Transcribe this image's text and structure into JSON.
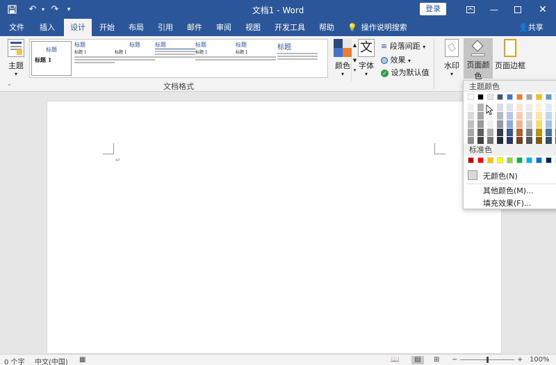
{
  "titlebar": {
    "title": "文档1 - Word",
    "login": "登录"
  },
  "tabs": [
    "文件",
    "插入",
    "设计",
    "开始",
    "布局",
    "引用",
    "邮件",
    "审阅",
    "视图",
    "开发工具",
    "帮助"
  ],
  "active_tab": "设计",
  "tell_me": "操作说明搜索",
  "share": "共享",
  "ribbon": {
    "theme": "主题",
    "theme_thumb_label": "标题 1",
    "gallery_titles": [
      "标题",
      "标题",
      "标题",
      "标题",
      "标题",
      "标题",
      "标题"
    ],
    "gallery_sub": [
      "标题 1",
      "标题 1",
      "标题 1",
      "标题 1"
    ],
    "doc_format_label": "文档格式",
    "colors": "颜色",
    "fonts": "字体",
    "paragraph_spacing": "段落间距",
    "effects": "效果",
    "set_default": "设为默认值",
    "watermark": "水印",
    "page_color": "页面颜色",
    "page_borders": "页面边框"
  },
  "dropdown": {
    "theme_colors": "主题颜色",
    "standard_colors": "标准色",
    "no_color": "无颜色(N)",
    "more_colors": "其他颜色(M)...",
    "fill_effects": "填充效果(F)...",
    "theme_top_row": [
      "#ffffff",
      "#000000",
      "#e7e6e6",
      "#44546a",
      "#4472c4",
      "#ed7d31",
      "#a5a5a5",
      "#ffc000",
      "#5b9bd5",
      "#70ad47"
    ],
    "standard_row": [
      "#c00000",
      "#ff0000",
      "#ffc000",
      "#ffff00",
      "#92d050",
      "#00b050",
      "#00b0f0",
      "#0070c0",
      "#002060",
      "#7030a0"
    ]
  },
  "statusbar": {
    "words": "0 个字",
    "language": "中文(中国)",
    "zoom": "100%"
  },
  "colors": {
    "brand": "#2b579a"
  }
}
